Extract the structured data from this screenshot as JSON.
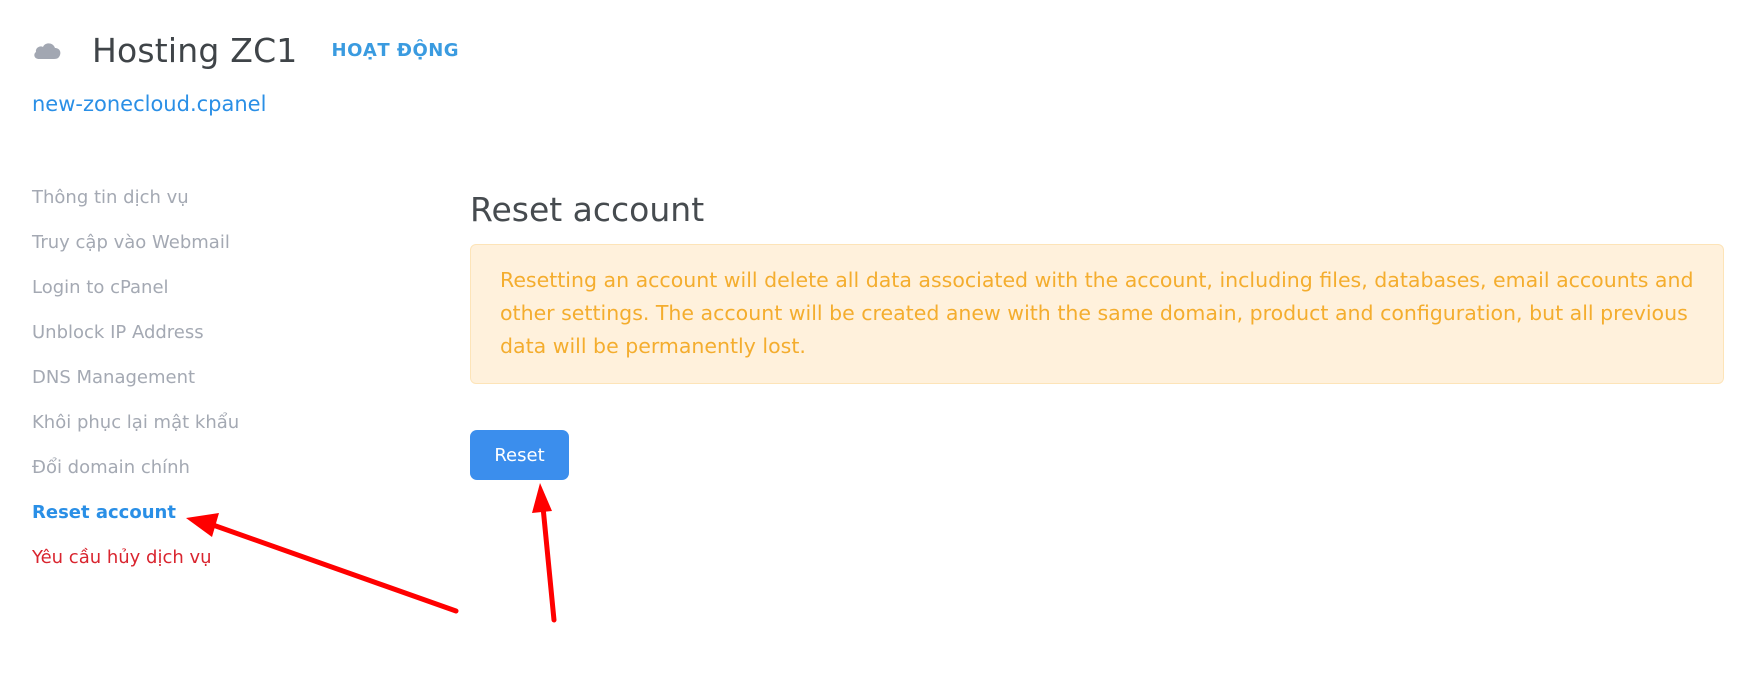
{
  "header": {
    "icon": "cloud-icon",
    "title": "Hosting ZC1",
    "status": "HOẠT ĐỘNG",
    "domain": "new-zonecloud.cpanel"
  },
  "sidebar": {
    "items": [
      {
        "label": "Thông tin dịch vụ",
        "state": "normal"
      },
      {
        "label": "Truy cập vào Webmail",
        "state": "normal"
      },
      {
        "label": "Login to cPanel",
        "state": "normal"
      },
      {
        "label": "Unblock IP Address",
        "state": "normal"
      },
      {
        "label": "DNS Management",
        "state": "normal"
      },
      {
        "label": "Khôi phục lại mật khẩu",
        "state": "normal"
      },
      {
        "label": "Đổi domain chính",
        "state": "normal"
      },
      {
        "label": "Reset account",
        "state": "active"
      },
      {
        "label": "Yêu cầu hủy dịch vụ",
        "state": "danger"
      }
    ]
  },
  "main": {
    "title": "Reset account",
    "warning": "Resetting an account will delete all data associated with the account, including files, databases, email accounts and other settings. The account will be created anew with the same domain, product and configuration, but all previous data will be permanently lost.",
    "button_label": "Reset"
  },
  "colors": {
    "accent": "#2a8fe6",
    "button": "#3b8eed",
    "warning_text": "#f4ad2e",
    "warning_bg": "#fff1dc",
    "danger": "#d9252f",
    "annotation_arrow": "#ff0000"
  }
}
